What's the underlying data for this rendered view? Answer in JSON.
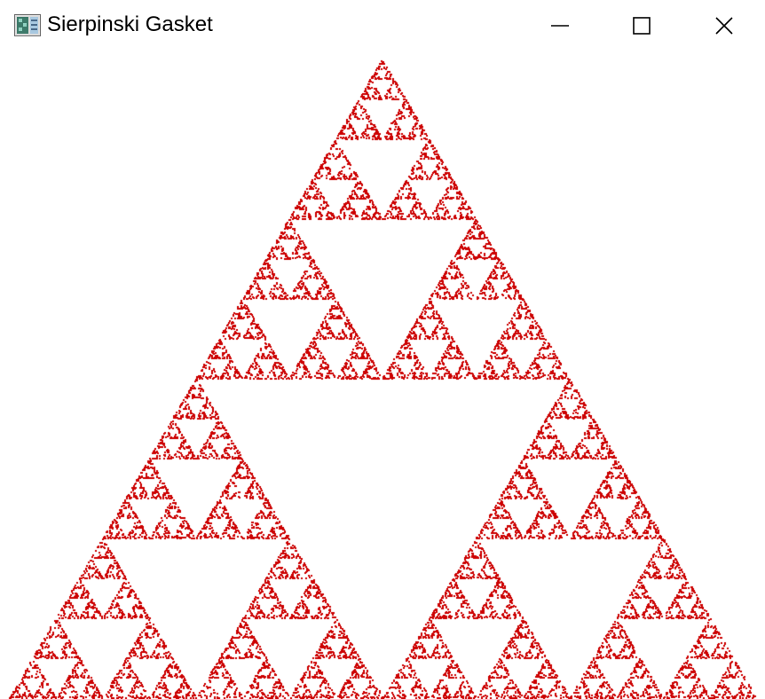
{
  "window": {
    "title": "Sierpinski Gasket",
    "icon": "application-icon",
    "controls": {
      "minimize": "minimize-icon",
      "maximize": "maximize-icon",
      "close": "close-icon"
    }
  },
  "canvas": {
    "figure": "Sierpinski gasket",
    "depth_levels_visible": 6,
    "point_color": "#cc0000",
    "background_color": "#ffffff"
  }
}
